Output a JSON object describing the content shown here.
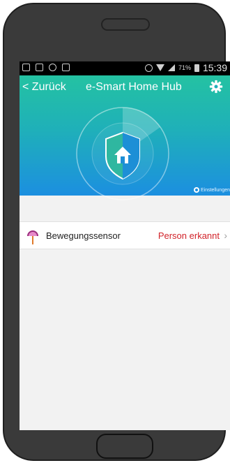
{
  "statusbar": {
    "battery_pct": "71%",
    "time": "15:39"
  },
  "header": {
    "back_label": "< Zurück",
    "title": "e-Smart Home Hub",
    "settings_link": "Einstellungen"
  },
  "sensors": [
    {
      "name": "Bewegungssensor",
      "status": "Person erkannt",
      "chevron": "›"
    }
  ],
  "colors": {
    "header_top": "#24c2a2",
    "header_bottom": "#1c8fe0",
    "status_alert": "#d2232a"
  },
  "icons": {
    "gear": "gear-icon",
    "shield": "shield-home-icon",
    "sensor": "motion-sensor-icon"
  }
}
